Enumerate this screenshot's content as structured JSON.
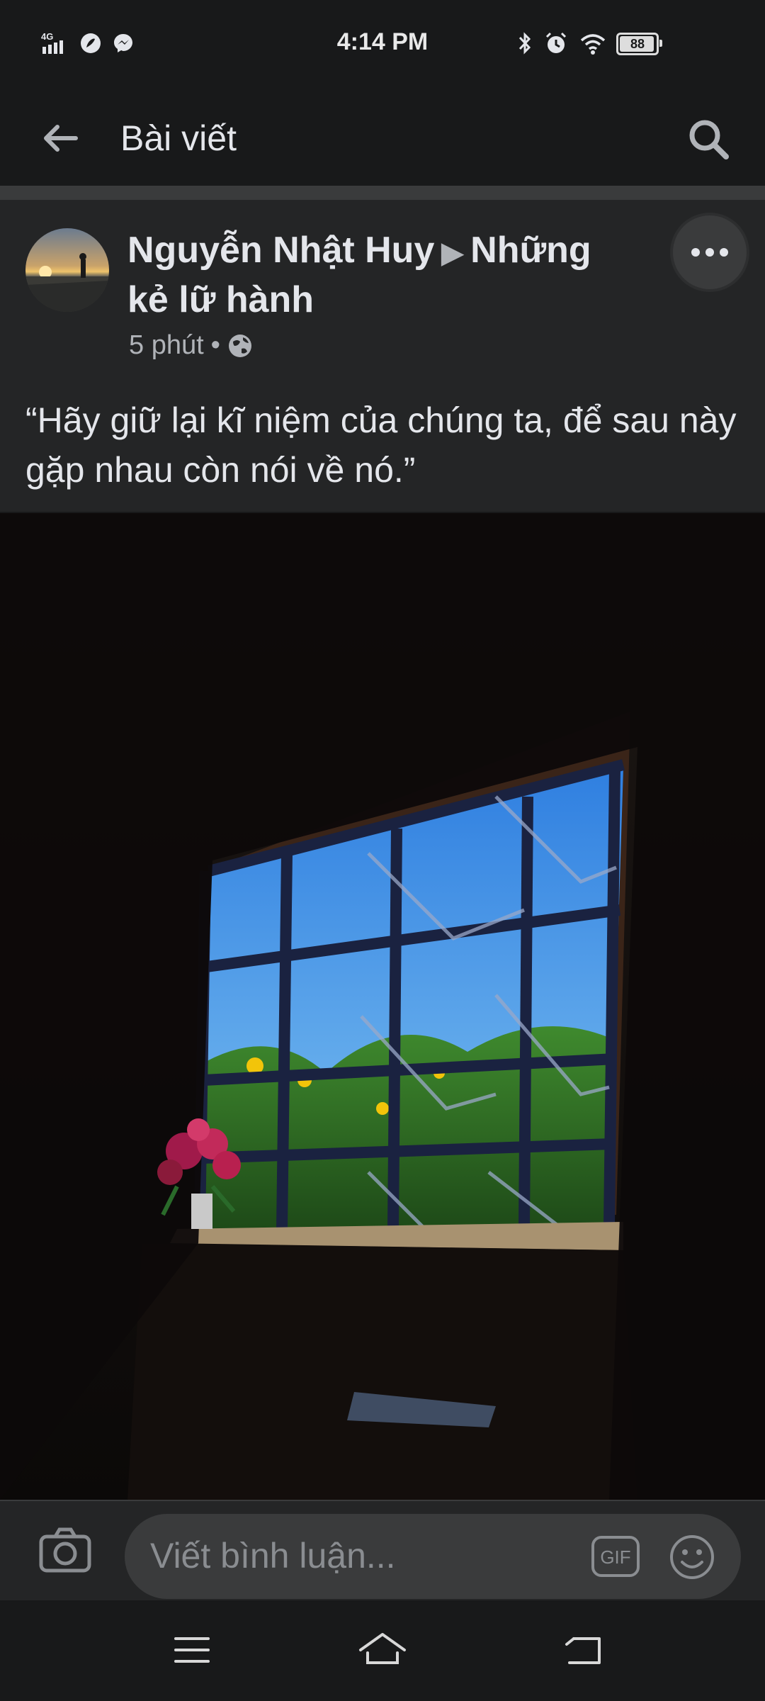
{
  "status": {
    "time": "4:14 PM",
    "network": "4G",
    "battery": "88",
    "battery_level": 0.88
  },
  "header": {
    "title": "Bài viết",
    "back_icon": "arrow-left-icon",
    "search_icon": "search-icon"
  },
  "post": {
    "author": "Nguyễn Nhật Huy",
    "group": "Những kẻ lữ hành",
    "time": "5 phút",
    "separator": "•",
    "privacy_icon": "globe-icon",
    "text": "“Hãy giữ lại kĩ niệm của chúng ta, để sau này gặp nhau còn nói về nó.”"
  },
  "comment": {
    "placeholder": "Viết bình luận...",
    "gif_label": "GIF"
  },
  "colors": {
    "background": "#18191a",
    "card": "#242526",
    "text": "#e4e6eb",
    "secondary": "#b0b3b8"
  }
}
